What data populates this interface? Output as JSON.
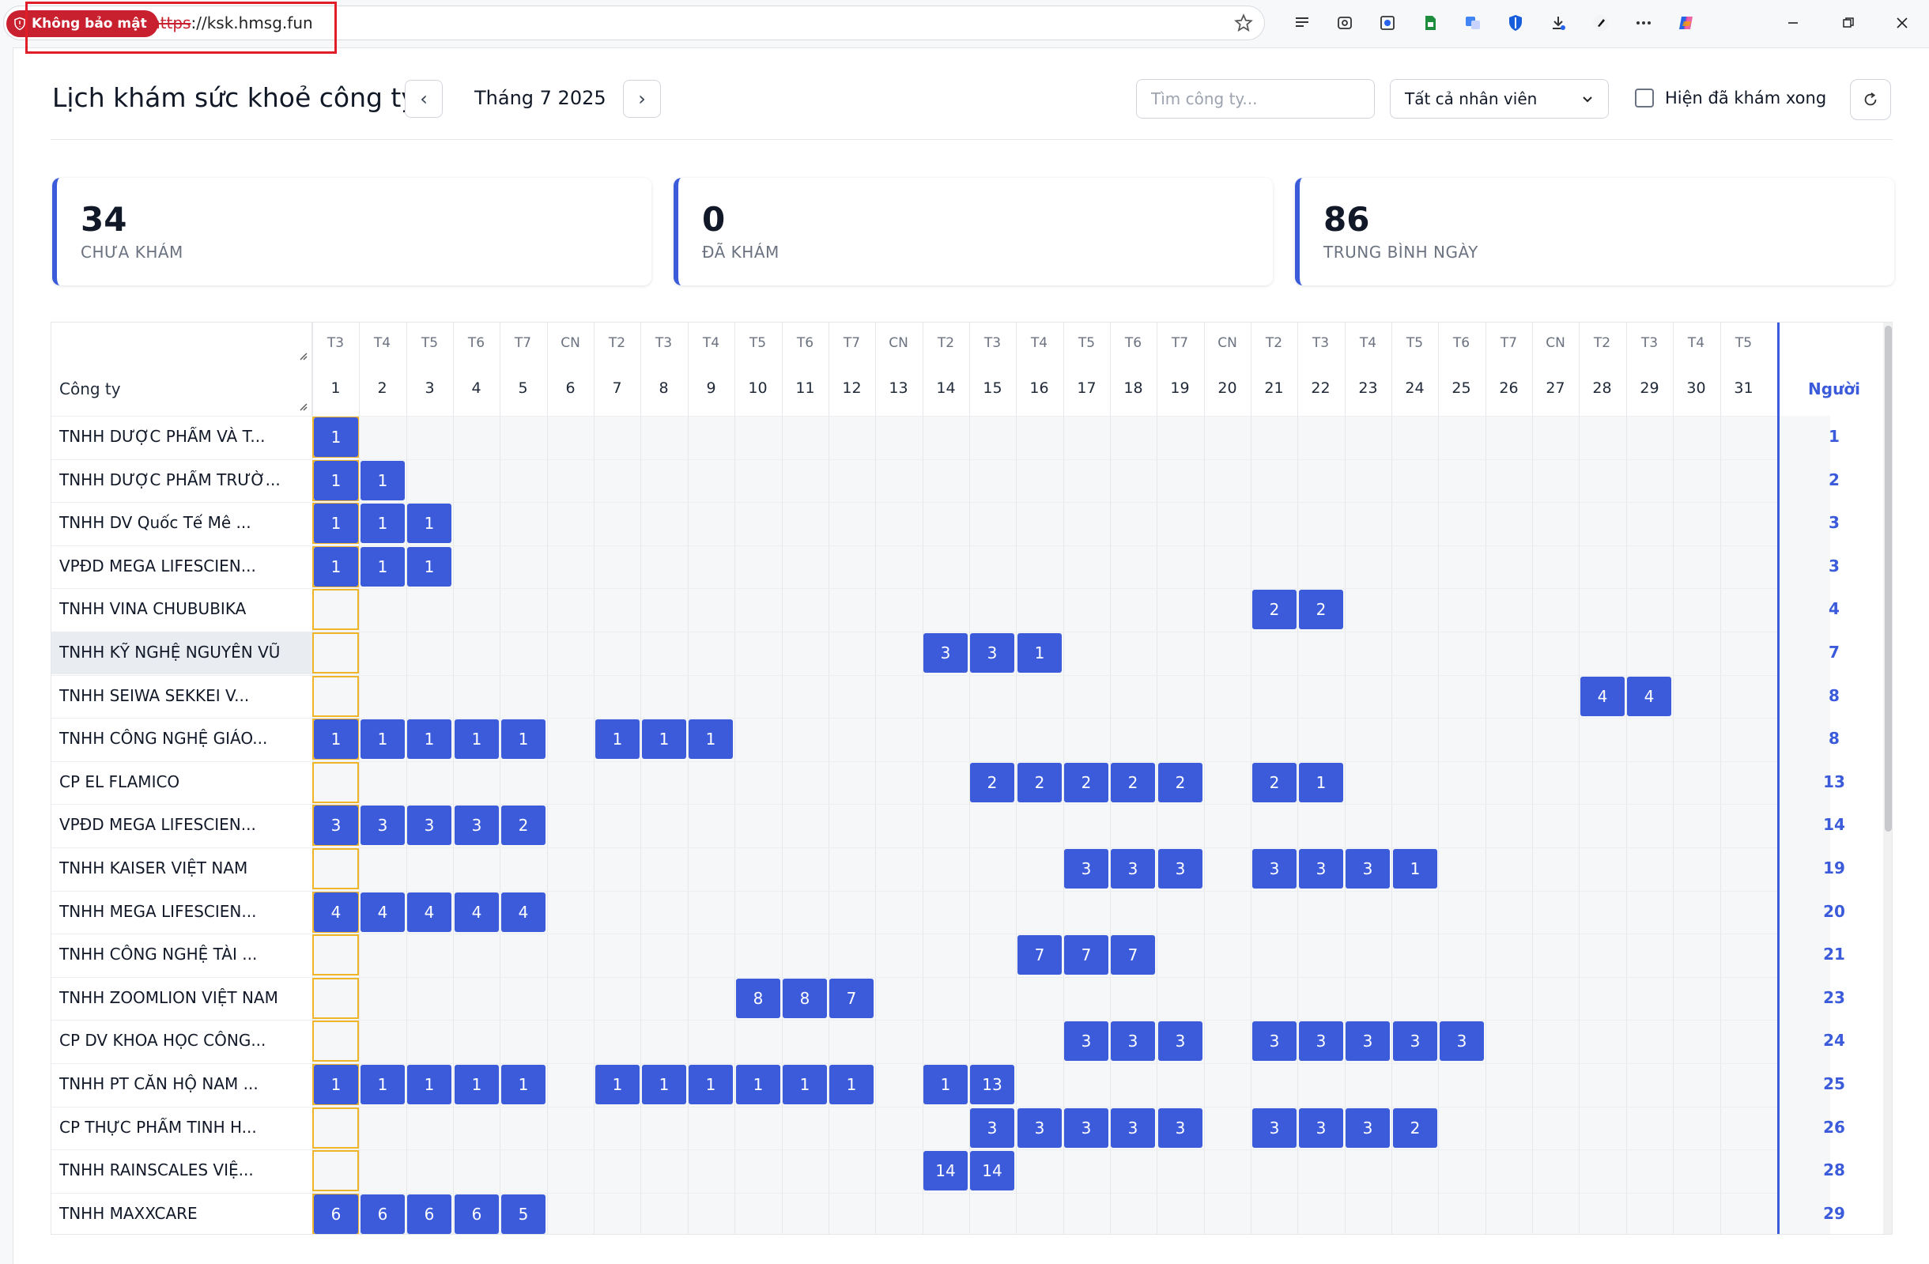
{
  "browser": {
    "security_label": "Không bảo mật",
    "url_scheme": "https",
    "url_rest": "://ksk.hmsg.fun"
  },
  "header": {
    "title": "Lịch khám sức khoẻ công ty",
    "prev_label": "‹",
    "next_label": "›",
    "month_label": "Tháng 7 2025",
    "search_placeholder": "Tìm công ty...",
    "employee_filter": "Tất cả nhân viên",
    "show_done_label": "Hiện đã khám xong",
    "show_done_checked": false
  },
  "stats": [
    {
      "value": "34",
      "label": "CHƯA KHÁM"
    },
    {
      "value": "0",
      "label": "ĐÃ KHÁM"
    },
    {
      "value": "86",
      "label": "TRUNG BÌNH NGÀY"
    }
  ],
  "grid": {
    "company_header": "Công ty",
    "total_header": "Người",
    "today_day": 1,
    "days": [
      {
        "wd": "T3",
        "d": "1"
      },
      {
        "wd": "T4",
        "d": "2"
      },
      {
        "wd": "T5",
        "d": "3"
      },
      {
        "wd": "T6",
        "d": "4"
      },
      {
        "wd": "T7",
        "d": "5"
      },
      {
        "wd": "CN",
        "d": "6"
      },
      {
        "wd": "T2",
        "d": "7"
      },
      {
        "wd": "T3",
        "d": "8"
      },
      {
        "wd": "T4",
        "d": "9"
      },
      {
        "wd": "T5",
        "d": "10"
      },
      {
        "wd": "T6",
        "d": "11"
      },
      {
        "wd": "T7",
        "d": "12"
      },
      {
        "wd": "CN",
        "d": "13"
      },
      {
        "wd": "T2",
        "d": "14"
      },
      {
        "wd": "T3",
        "d": "15"
      },
      {
        "wd": "T4",
        "d": "16"
      },
      {
        "wd": "T5",
        "d": "17"
      },
      {
        "wd": "T6",
        "d": "18"
      },
      {
        "wd": "T7",
        "d": "19"
      },
      {
        "wd": "CN",
        "d": "20"
      },
      {
        "wd": "T2",
        "d": "21"
      },
      {
        "wd": "T3",
        "d": "22"
      },
      {
        "wd": "T4",
        "d": "23"
      },
      {
        "wd": "T5",
        "d": "24"
      },
      {
        "wd": "T6",
        "d": "25"
      },
      {
        "wd": "T7",
        "d": "26"
      },
      {
        "wd": "CN",
        "d": "27"
      },
      {
        "wd": "T2",
        "d": "28"
      },
      {
        "wd": "T3",
        "d": "29"
      },
      {
        "wd": "T4",
        "d": "30"
      },
      {
        "wd": "T5",
        "d": "31"
      }
    ],
    "rows": [
      {
        "company": "TNHH DƯỢC PHẨM VÀ T...",
        "total": "1",
        "highlighted": false,
        "cells": {
          "1": "1"
        }
      },
      {
        "company": "TNHH DƯỢC PHẨM TRƯỜ...",
        "total": "2",
        "highlighted": false,
        "cells": {
          "1": "1",
          "2": "1"
        }
      },
      {
        "company": "TNHH DV Quốc Tế Mê ...",
        "total": "3",
        "highlighted": false,
        "cells": {
          "1": "1",
          "2": "1",
          "3": "1"
        }
      },
      {
        "company": "VPĐD MEGA LIFESCIEN...",
        "total": "3",
        "highlighted": false,
        "cells": {
          "1": "1",
          "2": "1",
          "3": "1"
        }
      },
      {
        "company": "TNHH VINA CHUBUBIKA",
        "total": "4",
        "highlighted": false,
        "cells": {
          "21": "2",
          "22": "2"
        }
      },
      {
        "company": "TNHH KỸ NGHỆ NGUYỄN VŨ",
        "total": "7",
        "highlighted": true,
        "cells": {
          "14": "3",
          "15": "3",
          "16": "1"
        }
      },
      {
        "company": "TNHH SEIWA SEKKEI V...",
        "total": "8",
        "highlighted": false,
        "cells": {
          "28": "4",
          "29": "4"
        }
      },
      {
        "company": "TNHH CÔNG NGHỆ GIÁO...",
        "total": "8",
        "highlighted": false,
        "cells": {
          "1": "1",
          "2": "1",
          "3": "1",
          "4": "1",
          "5": "1",
          "7": "1",
          "8": "1",
          "9": "1"
        }
      },
      {
        "company": "CP EL FLAMICO",
        "total": "13",
        "highlighted": false,
        "cells": {
          "15": "2",
          "16": "2",
          "17": "2",
          "18": "2",
          "19": "2",
          "21": "2",
          "22": "1"
        }
      },
      {
        "company": "VPĐD MEGA LIFESCIEN...",
        "total": "14",
        "highlighted": false,
        "cells": {
          "1": "3",
          "2": "3",
          "3": "3",
          "4": "3",
          "5": "2"
        }
      },
      {
        "company": "TNHH KAISER VIỆT NAM",
        "total": "19",
        "highlighted": false,
        "cells": {
          "17": "3",
          "18": "3",
          "19": "3",
          "21": "3",
          "22": "3",
          "23": "3",
          "24": "1"
        }
      },
      {
        "company": "TNHH MEGA LIFESCIEN...",
        "total": "20",
        "highlighted": false,
        "cells": {
          "1": "4",
          "2": "4",
          "3": "4",
          "4": "4",
          "5": "4"
        }
      },
      {
        "company": "TNHH CÔNG NGHỆ TÀI ...",
        "total": "21",
        "highlighted": false,
        "cells": {
          "16": "7",
          "17": "7",
          "18": "7"
        }
      },
      {
        "company": "TNHH ZOOMLION VIỆT NAM",
        "total": "23",
        "highlighted": false,
        "cells": {
          "10": "8",
          "11": "8",
          "12": "7"
        }
      },
      {
        "company": "CP DV KHOA HỌC CÔNG...",
        "total": "24",
        "highlighted": false,
        "cells": {
          "17": "3",
          "18": "3",
          "19": "3",
          "21": "3",
          "22": "3",
          "23": "3",
          "24": "3",
          "25": "3"
        }
      },
      {
        "company": "TNHH PT CĂN HỘ NAM ...",
        "total": "25",
        "highlighted": false,
        "cells": {
          "1": "1",
          "2": "1",
          "3": "1",
          "4": "1",
          "5": "1",
          "7": "1",
          "8": "1",
          "9": "1",
          "10": "1",
          "11": "1",
          "12": "1",
          "14": "1",
          "15": "13"
        }
      },
      {
        "company": "CP THỰC PHẨM TINH H...",
        "total": "26",
        "highlighted": false,
        "cells": {
          "15": "3",
          "16": "3",
          "17": "3",
          "18": "3",
          "19": "3",
          "21": "3",
          "22": "3",
          "23": "3",
          "24": "2"
        }
      },
      {
        "company": "TNHH RAINSCALES VIỆ...",
        "total": "28",
        "highlighted": false,
        "cells": {
          "14": "14",
          "15": "14"
        }
      },
      {
        "company": "TNHH MAXXCARE",
        "total": "29",
        "highlighted": false,
        "cells": {
          "1": "6",
          "2": "6",
          "3": "6",
          "4": "6",
          "5": "5"
        }
      }
    ]
  }
}
